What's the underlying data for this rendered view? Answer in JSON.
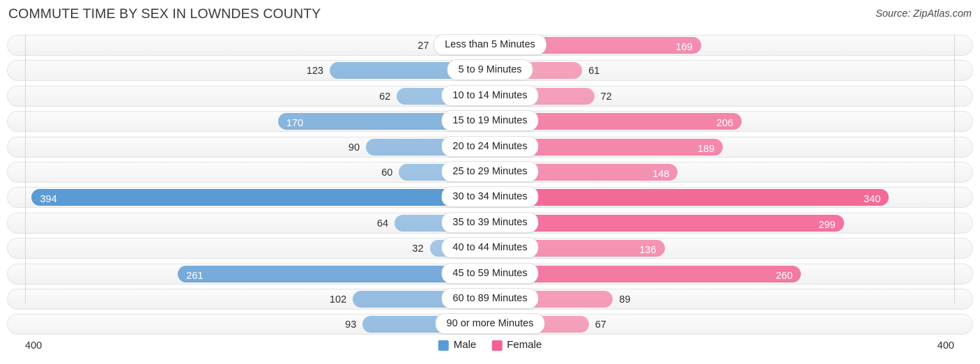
{
  "header": {
    "title": "COMMUTE TIME BY SEX IN LOWNDES COUNTY",
    "source": "Source: ZipAtlas.com"
  },
  "footer": {
    "axis_left_max": "400",
    "axis_right_max": "400"
  },
  "legend": {
    "items": [
      {
        "label": "Male",
        "color": "#5b9bd5"
      },
      {
        "label": "Female",
        "color": "#f4608f"
      }
    ]
  },
  "colors": {
    "male": "#5b9bd5",
    "female": "#f4608f",
    "track": "#f6f6f6",
    "track_border": "#e3e3e3",
    "axis_line": "#d4d4d4",
    "pill_background": "#ffffff",
    "title_text": "#3a3a3a"
  },
  "chart_data": {
    "type": "bar",
    "title": "COMMUTE TIME BY SEX IN LOWNDES COUNTY",
    "subtitle": "",
    "orientation": "horizontal-diverging",
    "xlabel": "",
    "ylabel": "",
    "axis_max": 400,
    "xlim": [
      400,
      400
    ],
    "grid": false,
    "legend_position": "bottom-center",
    "categories": [
      "Less than 5 Minutes",
      "5 to 9 Minutes",
      "10 to 14 Minutes",
      "15 to 19 Minutes",
      "20 to 24 Minutes",
      "25 to 29 Minutes",
      "30 to 34 Minutes",
      "35 to 39 Minutes",
      "40 to 44 Minutes",
      "45 to 59 Minutes",
      "60 to 89 Minutes",
      "90 or more Minutes"
    ],
    "series": [
      {
        "name": "Male",
        "color": "#5b9bd5",
        "values": [
          27,
          123,
          62,
          170,
          90,
          60,
          394,
          64,
          32,
          261,
          102,
          93
        ]
      },
      {
        "name": "Female",
        "color": "#f4608f",
        "values": [
          169,
          61,
          72,
          206,
          189,
          148,
          340,
          299,
          136,
          260,
          89,
          67
        ]
      }
    ]
  },
  "rows": [
    {
      "label": "Less than 5 Minutes",
      "male": 27,
      "female": 169,
      "male_text": "27",
      "female_text": "169"
    },
    {
      "label": "5 to 9 Minutes",
      "male": 123,
      "female": 61,
      "male_text": "123",
      "female_text": "61"
    },
    {
      "label": "10 to 14 Minutes",
      "male": 62,
      "female": 72,
      "male_text": "62",
      "female_text": "72"
    },
    {
      "label": "15 to 19 Minutes",
      "male": 170,
      "female": 206,
      "male_text": "170",
      "female_text": "206"
    },
    {
      "label": "20 to 24 Minutes",
      "male": 90,
      "female": 189,
      "male_text": "90",
      "female_text": "189"
    },
    {
      "label": "25 to 29 Minutes",
      "male": 60,
      "female": 148,
      "male_text": "60",
      "female_text": "148"
    },
    {
      "label": "30 to 34 Minutes",
      "male": 394,
      "female": 340,
      "male_text": "394",
      "female_text": "340"
    },
    {
      "label": "35 to 39 Minutes",
      "male": 64,
      "female": 299,
      "male_text": "64",
      "female_text": "299"
    },
    {
      "label": "40 to 44 Minutes",
      "male": 32,
      "female": 136,
      "male_text": "32",
      "female_text": "136"
    },
    {
      "label": "45 to 59 Minutes",
      "male": 261,
      "female": 260,
      "male_text": "261",
      "female_text": "260"
    },
    {
      "label": "60 to 89 Minutes",
      "male": 102,
      "female": 89,
      "male_text": "102",
      "female_text": "89"
    },
    {
      "label": "90 or more Minutes",
      "male": 93,
      "female": 67,
      "male_text": "93",
      "female_text": "67"
    }
  ]
}
